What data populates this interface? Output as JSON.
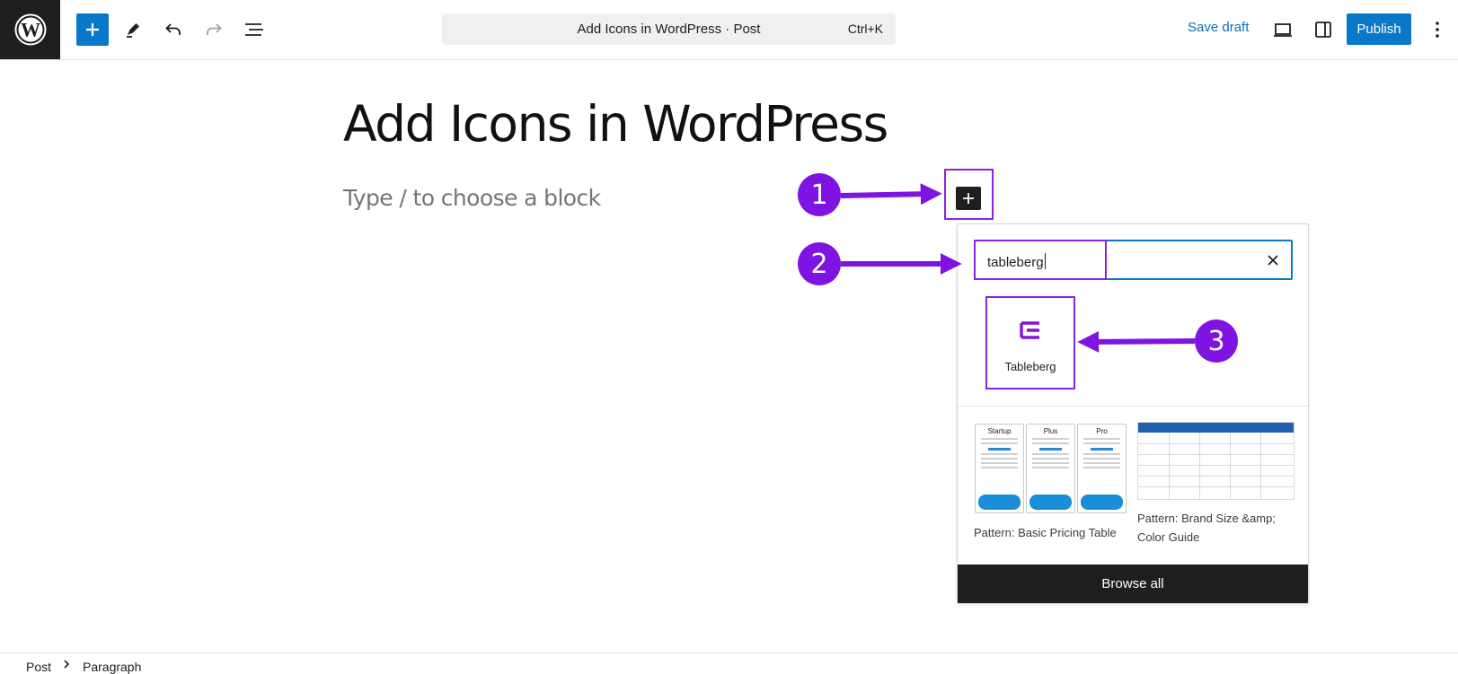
{
  "header": {
    "command_bar": {
      "title": "Add Icons in WordPress · Post",
      "shortcut": "Ctrl+K"
    },
    "save_draft_label": "Save draft",
    "publish_label": "Publish",
    "icons": [
      "wordpress-logo-icon",
      "plus-icon",
      "pencil-icon",
      "undo-icon",
      "redo-icon",
      "document-overview-icon",
      "desktop-preview-icon",
      "sidebar-toggle-icon",
      "more-options-icon"
    ]
  },
  "editor": {
    "post_title": "Add Icons in WordPress",
    "block_placeholder": "Type / to choose a block"
  },
  "inserter": {
    "search": {
      "value": "tableberg"
    },
    "results": [
      {
        "label": "Tableberg",
        "icon": "tableberg-icon"
      }
    ],
    "patterns": [
      {
        "label": "Pattern: Basic Pricing Table",
        "columns": [
          "Startup",
          "Plus",
          "Pro"
        ]
      },
      {
        "label": "Pattern: Brand Size &amp; Color Guide"
      }
    ],
    "browse_all_label": "Browse all"
  },
  "annotations": {
    "color": "#7f14e2",
    "steps": [
      "1",
      "2",
      "3"
    ]
  },
  "breadcrumb": {
    "items": [
      "Post",
      "Paragraph"
    ]
  }
}
